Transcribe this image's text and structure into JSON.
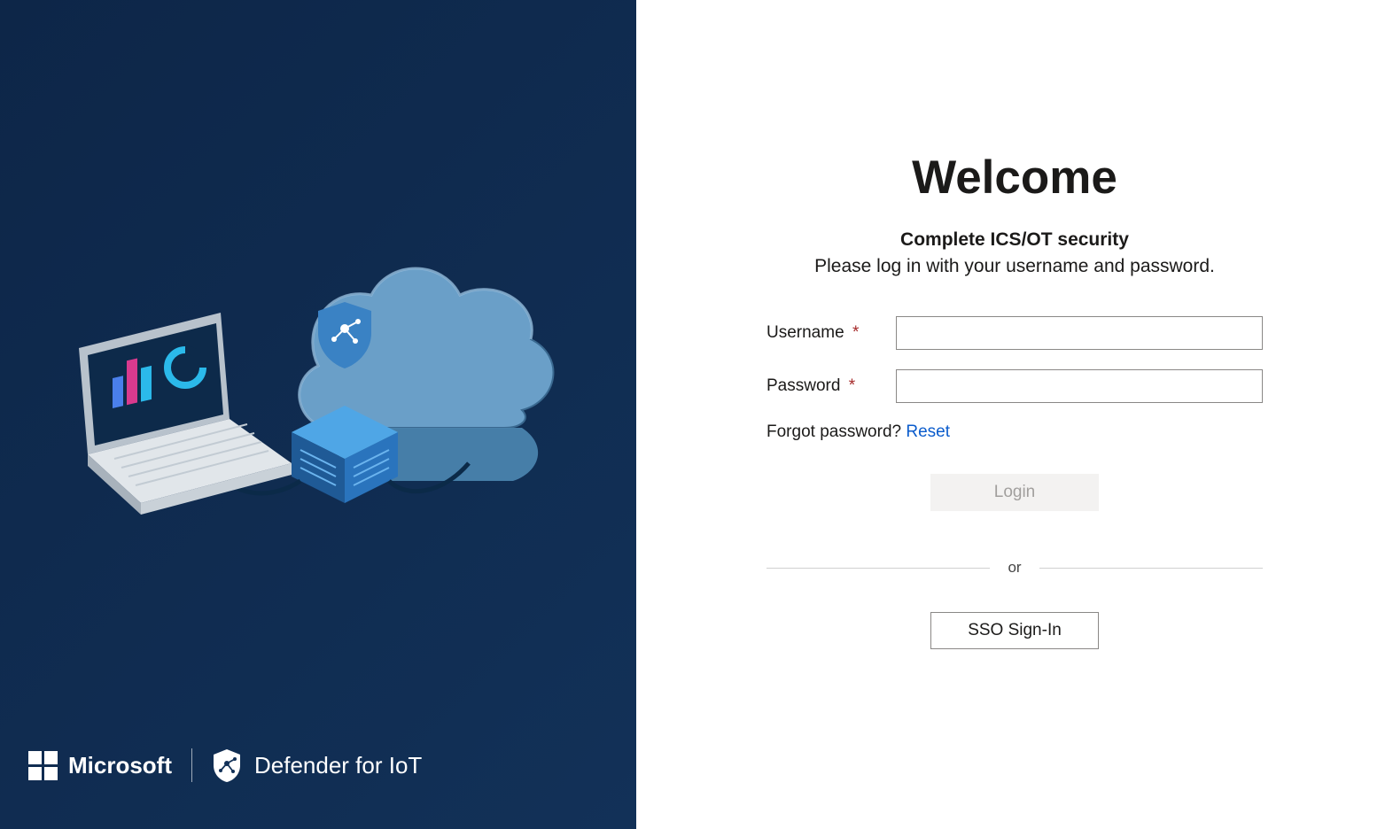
{
  "brand": {
    "microsoft_label": "Microsoft",
    "product_label": "Defender for IoT"
  },
  "login": {
    "heading": "Welcome",
    "subtitle_bold": "Complete ICS/OT security",
    "subtitle_text": "Please log in with your username and password.",
    "username_label": "Username",
    "password_label": "Password",
    "required_asterisk": "*",
    "username_value": "",
    "password_value": "",
    "forgot_label": "Forgot password? ",
    "reset_label": "Reset",
    "login_button": "Login",
    "or_label": "or",
    "sso_button": "SSO Sign-In"
  }
}
